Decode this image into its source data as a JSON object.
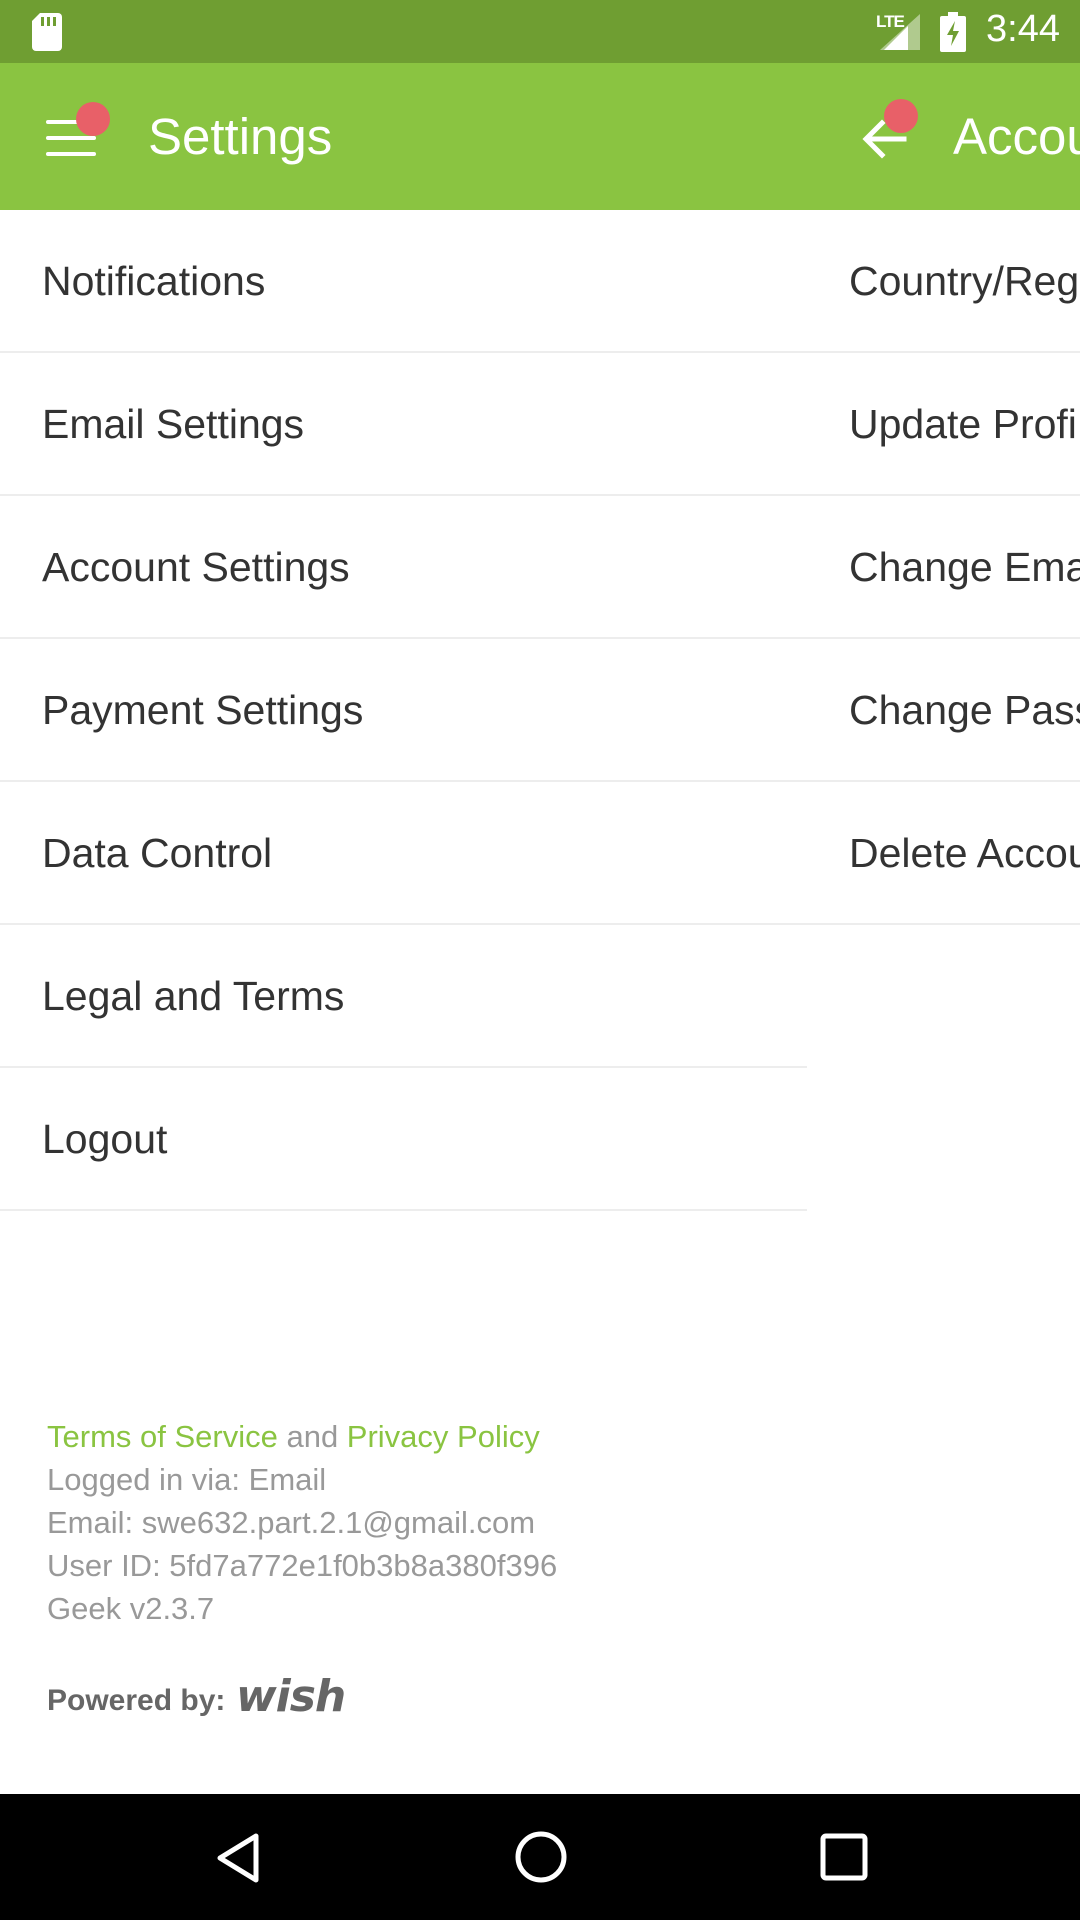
{
  "status_bar": {
    "time": "3:44",
    "network": "LTE",
    "icons": [
      "sd-card-icon",
      "signal-icon",
      "battery-charging-icon"
    ]
  },
  "app_bar": {
    "title": "Settings",
    "secondary_title": "Accou",
    "icons": [
      "menu-icon",
      "back-arrow-icon"
    ],
    "badge_color": "#e86068",
    "color": "#8ac441"
  },
  "settings_menu": {
    "items": [
      {
        "label": "Notifications"
      },
      {
        "label": "Email Settings"
      },
      {
        "label": "Account Settings"
      },
      {
        "label": "Payment Settings"
      },
      {
        "label": "Data Control"
      },
      {
        "label": "Legal and Terms"
      },
      {
        "label": "Logout"
      }
    ]
  },
  "account_panel": {
    "items": [
      {
        "label": "Country/Reg"
      },
      {
        "label": "Update Profi"
      },
      {
        "label": "Change Ema"
      },
      {
        "label": "Change Pass"
      },
      {
        "label": "Delete Accou"
      }
    ]
  },
  "footer": {
    "terms_link": "Terms of Service",
    "and_text": " and ",
    "privacy_link": "Privacy Policy",
    "logged_in": "Logged in via: Email",
    "email": "Email: swe632.part.2.1@gmail.com",
    "user_id": "User ID: 5fd7a772e1f0b3b8a380f396",
    "version": "Geek v2.3.7",
    "powered_by": "Powered by:",
    "brand": "wish",
    "link_color": "#8ac441"
  },
  "nav_bar": {
    "icons": [
      "back-triangle-icon",
      "home-circle-icon",
      "recents-square-icon"
    ]
  }
}
